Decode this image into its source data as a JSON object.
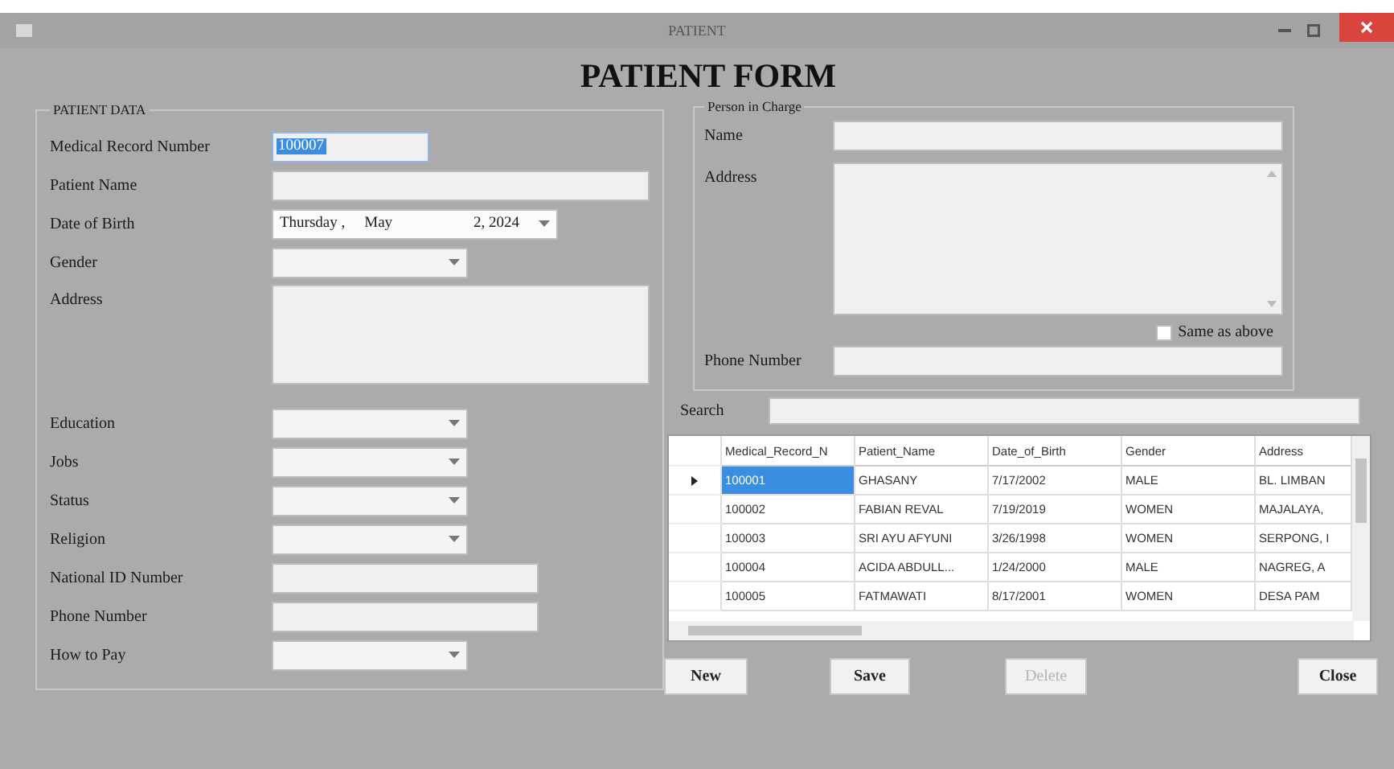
{
  "window": {
    "title": "PATIENT"
  },
  "heading": "PATIENT FORM",
  "patient_data": {
    "legend": "PATIENT DATA",
    "fields": [
      {
        "label": "Medical Record Number",
        "kind": "code",
        "value": "100007",
        "value_selected": true
      },
      {
        "label": "Patient Name",
        "kind": "text"
      },
      {
        "label": "Date of Birth",
        "kind": "date",
        "date_parts": [
          "Thursday ,",
          "May",
          "2, 2024"
        ]
      },
      {
        "label": "Gender",
        "kind": "select"
      },
      {
        "label": "Address",
        "kind": "textarea"
      },
      {
        "label": "Education",
        "kind": "select"
      },
      {
        "label": "Jobs",
        "kind": "select"
      },
      {
        "label": "Status",
        "kind": "select"
      },
      {
        "label": "Religion",
        "kind": "select"
      },
      {
        "label": "National ID Number",
        "kind": "number"
      },
      {
        "label": "Phone Number",
        "kind": "number"
      },
      {
        "label": "How to Pay",
        "kind": "select"
      }
    ]
  },
  "person_in_charge": {
    "legend": "Person in Charge",
    "name_label": "Name",
    "address_label": "Address",
    "same_as_above": {
      "label": "Same as above",
      "checked": false
    },
    "phone_label": "Phone Number"
  },
  "search": {
    "label": "Search"
  },
  "table": {
    "columns": [
      "Medical_Record_N",
      "Patient_Name",
      "Date_of_Birth",
      "Gender",
      "Address"
    ],
    "rows": [
      {
        "current": true,
        "cells": [
          "100001",
          "GHASANY",
          "7/17/2002",
          "MALE",
          "BL. LIMBAN"
        ]
      },
      {
        "current": false,
        "cells": [
          "100002",
          "FABIAN REVAL",
          "7/19/2019",
          "WOMEN",
          "MAJALAYA,"
        ]
      },
      {
        "current": false,
        "cells": [
          "100003",
          "SRI AYU AFYUNI",
          "3/26/1998",
          "WOMEN",
          "SERPONG, I"
        ]
      },
      {
        "current": false,
        "cells": [
          "100004",
          "ACIDA ABDULL...",
          "1/24/2000",
          "MALE",
          "NAGREG, A"
        ]
      },
      {
        "current": false,
        "cells": [
          "100005",
          "FATMAWATI",
          "8/17/2001",
          "WOMEN",
          "DESA PAM"
        ]
      }
    ]
  },
  "buttons": [
    {
      "kind": "new",
      "label": "New",
      "disabled": false
    },
    {
      "kind": "save",
      "label": "Save",
      "disabled": false
    },
    {
      "kind": "delete",
      "label": "Delete",
      "disabled": true
    },
    {
      "kind": "close",
      "label": "Close",
      "disabled": false
    }
  ]
}
